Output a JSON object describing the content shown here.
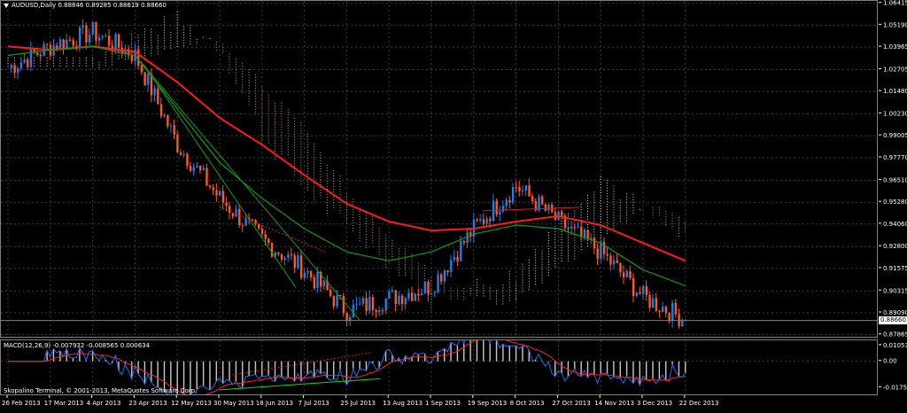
{
  "window": {
    "symbol_title": "AUDUSD,Daily",
    "ohlc": "0.88846 0.89285 0.88619 0.88660"
  },
  "price_scale": {
    "labels": [
      "1.06415",
      "1.05190",
      "1.03965",
      "1.02705",
      "1.01480",
      "1.00230",
      "0.99005",
      "0.97770",
      "0.96510",
      "0.95280",
      "0.94060",
      "0.92800",
      "0.91575",
      "0.90315",
      "0.89090",
      "0.87865"
    ],
    "current_price": "0.88660"
  },
  "time_axis": {
    "labels": [
      "26 Feb 2013",
      "17 Mar 2013",
      "4 Apr 2013",
      "23 Apr 2013",
      "12 May 2013",
      "30 May 2013",
      "18 Jun 2013",
      "7 Jul 2013",
      "25 Jul 2013",
      "13 Aug 2013",
      "1 Sep 2013",
      "19 Sep 2013",
      "8 Oct 2013",
      "27 Oct 2013",
      "14 Nov 2013",
      "3 Dec 2013",
      "22 Dec 2013"
    ]
  },
  "macd": {
    "title": "MACD(12,26,9) -0.007932 -0.008565 0.000634",
    "scale_labels": [
      "0.01053",
      "0.00",
      "-0.01759"
    ]
  },
  "footer": {
    "copyright": "Skopalino Terminal, © 2001-2013, MetaQuotes Software Corp."
  },
  "colors": {
    "background": "#000000",
    "grid": "#3a3a3a",
    "bull_candle": "#1e7ee8",
    "bear_candle": "#ff5a1a",
    "ma_slow": "#ff1a1a",
    "ma_mid": "#0d9c0d",
    "cloud_a": "#e8b090",
    "cloud_b": "#ffffff",
    "macd_main": "#1e6ee8",
    "macd_signal": "#ff2020",
    "histogram": "#c8c8c8"
  },
  "chart_data": {
    "type": "line",
    "symbol": "AUDUSD",
    "timeframe": "Daily",
    "ylim": [
      0.8775,
      1.0655
    ],
    "x": [
      "26 Feb 2013",
      "17 Mar 2013",
      "4 Apr 2013",
      "23 Apr 2013",
      "12 May 2013",
      "30 May 2013",
      "18 Jun 2013",
      "7 Jul 2013",
      "25 Jul 2013",
      "13 Aug 2013",
      "1 Sep 2013",
      "19 Sep 2013",
      "8 Oct 2013",
      "27 Oct 2013",
      "14 Nov 2013",
      "3 Dec 2013",
      "22 Dec 2013"
    ],
    "series": [
      {
        "values": [
          1.028,
          1.04,
          1.048,
          1.035,
          0.985,
          0.955,
          0.932,
          0.915,
          0.892,
          0.899,
          0.906,
          0.938,
          0.962,
          0.942,
          0.925,
          0.9,
          0.887
        ]
      },
      {
        "values": [
          1.04,
          1.038,
          1.04,
          1.037,
          1.02,
          1.0,
          0.985,
          0.968,
          0.952,
          0.942,
          0.937,
          0.938,
          0.942,
          0.945,
          0.94,
          0.93,
          0.92
        ]
      },
      {
        "values": [
          1.035,
          1.038,
          1.04,
          1.035,
          1.005,
          0.975,
          0.955,
          0.938,
          0.925,
          0.92,
          0.925,
          0.935,
          0.94,
          0.938,
          0.93,
          0.915,
          0.906
        ]
      }
    ]
  }
}
